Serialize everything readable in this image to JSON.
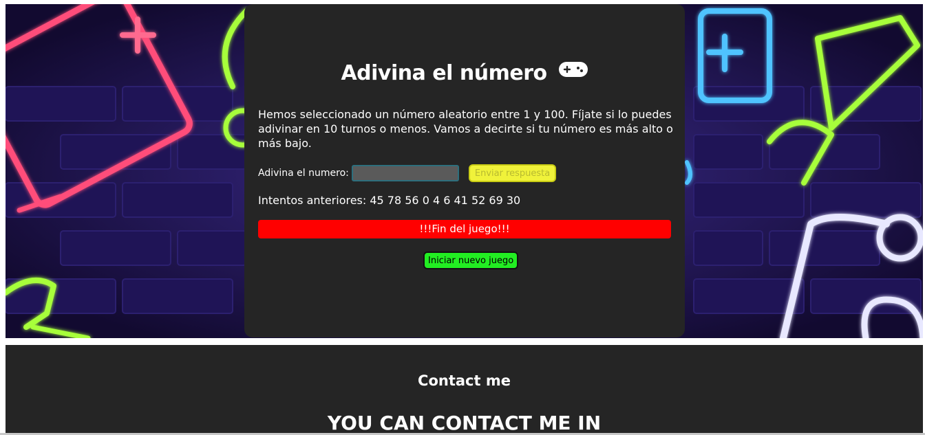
{
  "game": {
    "title": "Adivina el número",
    "title_icon": "gamepad-icon",
    "description": "Hemos seleccionado un número aleatorio entre 1 y 100. Fíjate si lo puedes adivinar en 10 turnos o menos. Vamos a decirte si tu número es más alto o más bajo.",
    "guess_label": "Adivina el numero:",
    "guess_value": "",
    "submit_label": "Enviar respuesta",
    "previous_guesses": "Intentos anteriores: 45 78 56 0 4 6 41 52 69 30",
    "result_message": "!!!Fin del juego!!!",
    "result_color": "#ff0000",
    "new_game_label": "Iniciar nuevo juego"
  },
  "footer": {
    "title": "Contact me",
    "subtitle": "YOU CAN CONTACT ME IN"
  },
  "colors": {
    "card_bg": "#252525",
    "submit_bg": "#f0f23a",
    "new_game_bg": "#22ee22",
    "hero_bg": "#1a1040"
  }
}
